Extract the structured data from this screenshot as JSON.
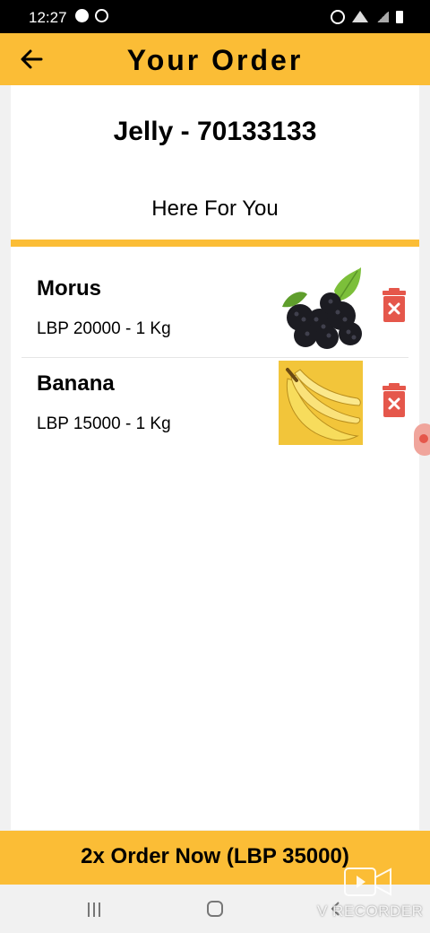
{
  "status_bar": {
    "time": "12:27"
  },
  "app_bar": {
    "title": "Your Order"
  },
  "store": {
    "name": "Jelly - 70133133",
    "subtitle": "Here For You"
  },
  "items": [
    {
      "name": "Morus",
      "price": "LBP 20000 - 1 Kg",
      "image": "blackberries-image"
    },
    {
      "name": "Banana",
      "price": "LBP 15000 - 1 Kg",
      "image": "bananas-image"
    }
  ],
  "order_button": {
    "label": "2x Order Now (LBP 35000)"
  },
  "watermark": {
    "text": "V RECORDER"
  },
  "colors": {
    "accent": "#fbbd36",
    "delete": "#e5574b"
  }
}
